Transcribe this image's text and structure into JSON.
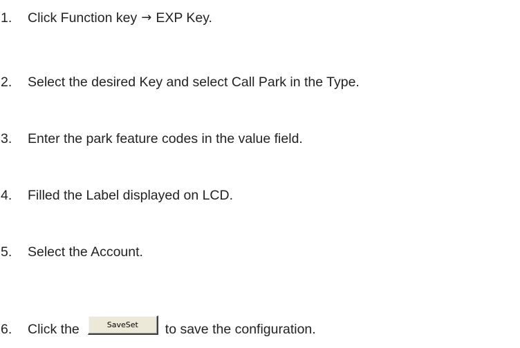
{
  "steps": [
    {
      "number": "1.",
      "before": "Click Function key",
      "arrow": "→",
      "after": "EXP Key."
    },
    {
      "number": "2.",
      "text": "Select the desired Key and select Call Park in the Type."
    },
    {
      "number": "3.",
      "text": "Enter the park feature codes in the value field."
    },
    {
      "number": "4.",
      "text": "Filled the Label displayed on LCD."
    },
    {
      "number": "5.",
      "text": "Select the Account."
    },
    {
      "number": "6.",
      "before": "Click the",
      "button_label": "SaveSet",
      "after": "to save the configuration."
    }
  ]
}
